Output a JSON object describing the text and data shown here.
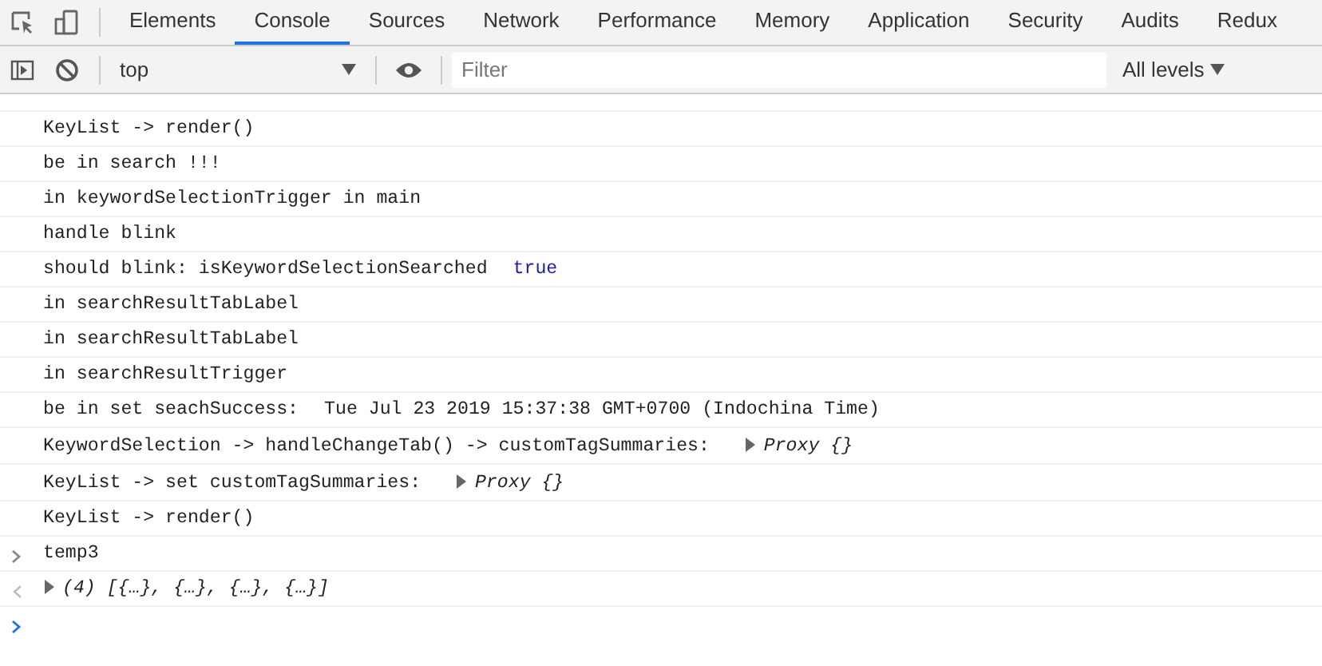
{
  "tabs": [
    {
      "label": "Elements",
      "selected": false
    },
    {
      "label": "Console",
      "selected": true
    },
    {
      "label": "Sources",
      "selected": false
    },
    {
      "label": "Network",
      "selected": false
    },
    {
      "label": "Performance",
      "selected": false
    },
    {
      "label": "Memory",
      "selected": false
    },
    {
      "label": "Application",
      "selected": false
    },
    {
      "label": "Security",
      "selected": false
    },
    {
      "label": "Audits",
      "selected": false
    },
    {
      "label": "Redux",
      "selected": false
    }
  ],
  "toolbar": {
    "context": "top",
    "filter": {
      "placeholder": "Filter"
    },
    "levels": "All levels"
  },
  "console": [
    {
      "kind": "log",
      "text": "KeyList -> render()"
    },
    {
      "kind": "log",
      "text": "be in search !!!"
    },
    {
      "kind": "log",
      "text": "in keywordSelectionTrigger in main"
    },
    {
      "kind": "log",
      "text": "handle blink"
    },
    {
      "kind": "log",
      "text": "should blink: isKeywordSelectionSearched",
      "value": {
        "kind": "boolean",
        "text": "true"
      }
    },
    {
      "kind": "log",
      "text": "in searchResultTabLabel"
    },
    {
      "kind": "log",
      "text": "in searchResultTabLabel"
    },
    {
      "kind": "log",
      "text": "in searchResultTrigger"
    },
    {
      "kind": "log",
      "text": "be in set seachSuccess:",
      "value": {
        "kind": "string",
        "text": "Tue Jul 23 2019 15:37:38 GMT+0700 (Indochina Time)"
      }
    },
    {
      "kind": "log",
      "text": "KeywordSelection -> handleChangeTab() -> customTagSummaries:",
      "value": {
        "kind": "object",
        "text": "Proxy {}"
      }
    },
    {
      "kind": "log",
      "text": "KeyList -> set customTagSummaries:",
      "value": {
        "kind": "object",
        "text": "Proxy {}"
      }
    },
    {
      "kind": "log",
      "text": "KeyList -> render()"
    },
    {
      "kind": "input",
      "text": "temp3"
    },
    {
      "kind": "result",
      "text": "(4) [{…}, {…}, {…}, {…}]"
    },
    {
      "kind": "prompt"
    }
  ]
}
